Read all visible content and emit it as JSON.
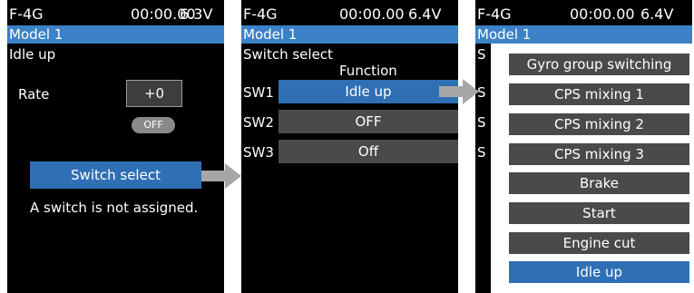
{
  "screen1": {
    "status": {
      "model_id": "F-4G",
      "timer": "00:00.00",
      "voltage": "6.3V"
    },
    "model_name": "Model 1",
    "page_title": "Idle up",
    "rate_label": "Rate",
    "rate_value": "+0",
    "toggle_label": "OFF",
    "switch_select_button": "Switch select",
    "message": "A switch is not assigned."
  },
  "screen2": {
    "status": {
      "model_id": "F-4G",
      "timer": "00:00.00",
      "voltage": "6.4V"
    },
    "model_name": "Model 1",
    "page_title": "Switch select",
    "column_header": "Function",
    "rows": [
      {
        "switch": "SW1",
        "function": "Idle up"
      },
      {
        "switch": "SW2",
        "function": "OFF"
      },
      {
        "switch": "SW3",
        "function": "Off"
      }
    ]
  },
  "screen3": {
    "status": {
      "model_id": "F-4G",
      "timer": "00:00.00",
      "voltage": "6.4V"
    },
    "model_name": "Model 1",
    "edge_letter": "S",
    "options": [
      "Gyro group switching",
      "CPS mixing 1",
      "CPS mixing 2",
      "CPS mixing 3",
      "Brake",
      "Start",
      "Engine cut",
      "Idle up"
    ],
    "selected_option": "Idle up"
  },
  "colors": {
    "accent": "#3d82c7",
    "selected": "#2f6fb4",
    "button": "#4a4a4a",
    "pager_active": "#e02020",
    "arrow": "#a6a6a6"
  }
}
